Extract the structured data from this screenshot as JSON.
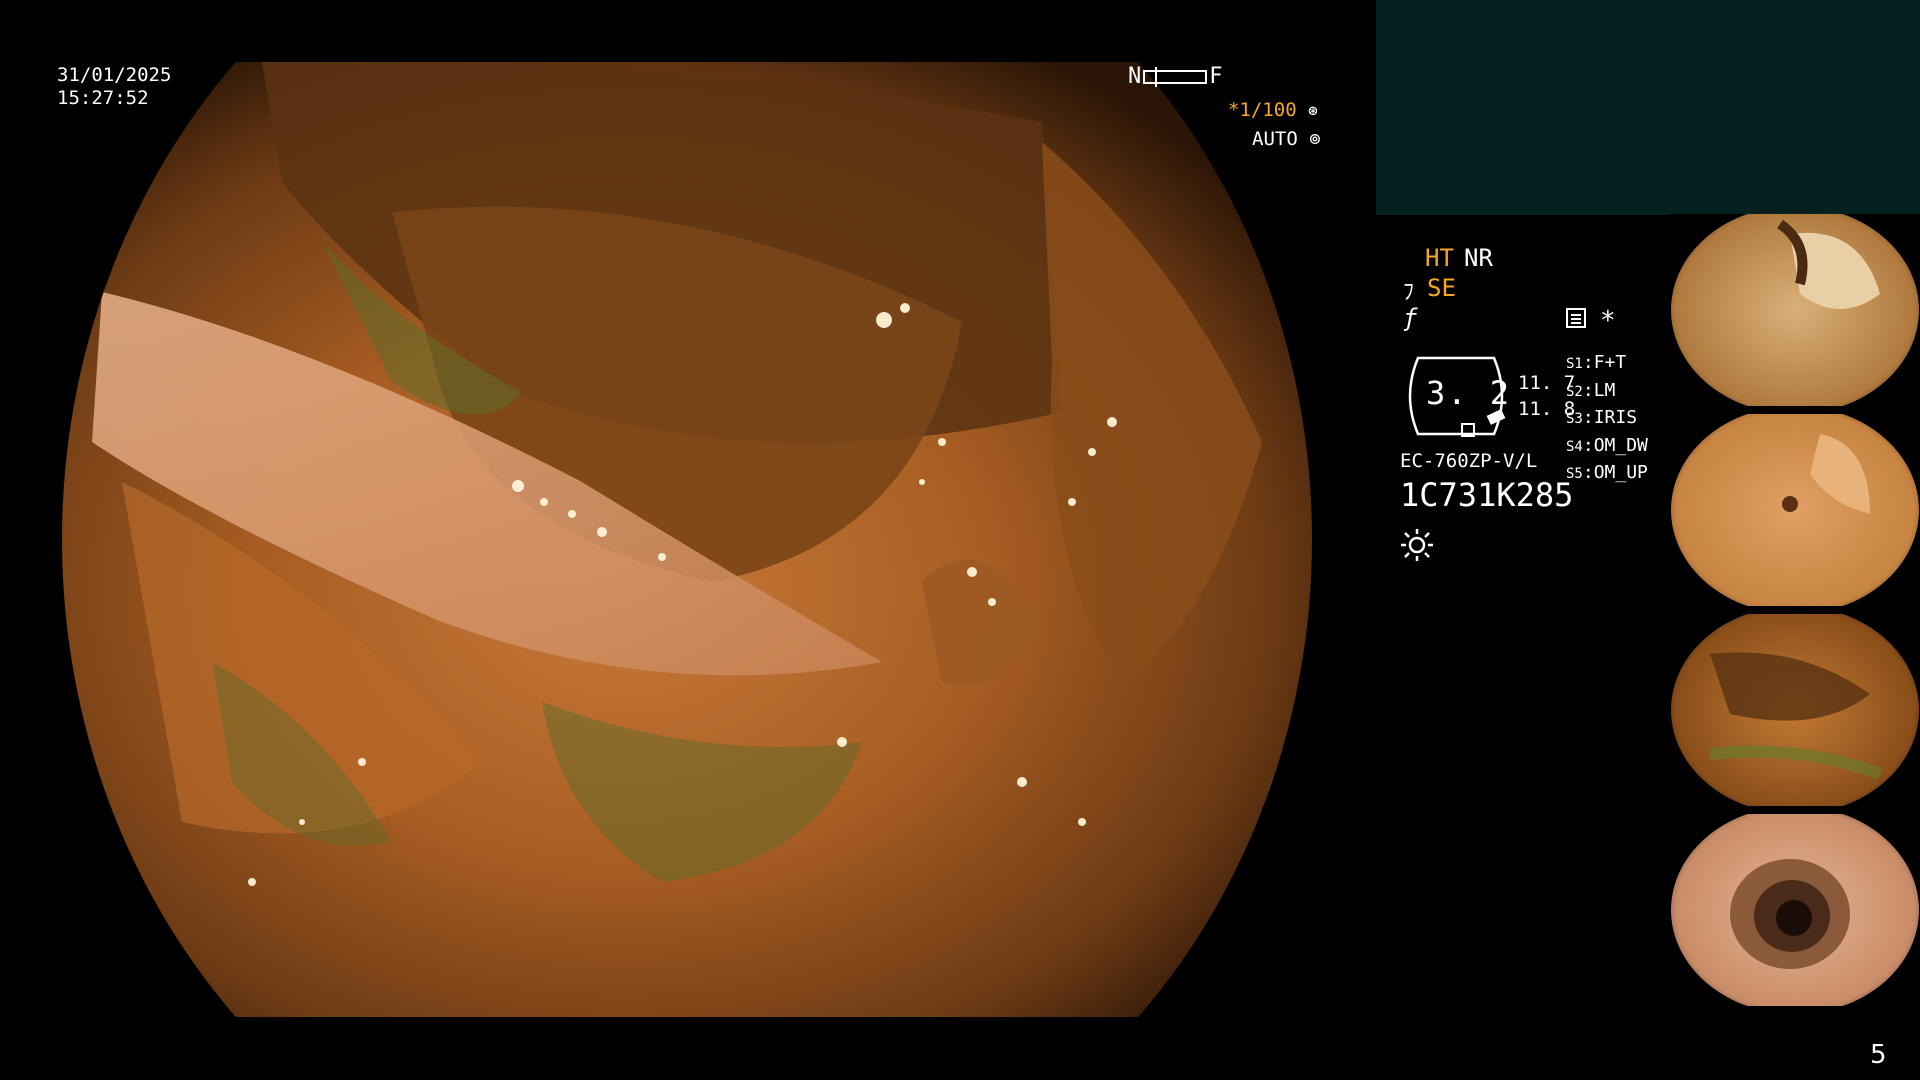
{
  "overlay": {
    "date": "31/01/2025",
    "time": "15:27:52",
    "near_label": "N",
    "far_label": "F",
    "shutter": "*1/100",
    "shutter_icon": "shutter-icon",
    "iris_mode": "AUTO",
    "iris_icon": "iris-icon"
  },
  "panel": {
    "ht": "HT",
    "nr": "NR",
    "se": "SE",
    "se_icon": "wand-icon",
    "f_icon": "f-icon",
    "star": "*",
    "dial_value": "3. 2",
    "value_1": "11. 7",
    "value_2": "11. 8",
    "slots": [
      {
        "key": "S1",
        "value": "F+T"
      },
      {
        "key": "S2",
        "value": "LM"
      },
      {
        "key": "S3",
        "value": "IRIS"
      },
      {
        "key": "S4",
        "value": "OM_DW"
      },
      {
        "key": "S5",
        "value": "OM_UP"
      }
    ],
    "model": "EC-760ZP-V/L",
    "serial": "1C731K285",
    "accent_color": "#f5a623",
    "panel_color": "#04201f"
  },
  "page_number": "5"
}
